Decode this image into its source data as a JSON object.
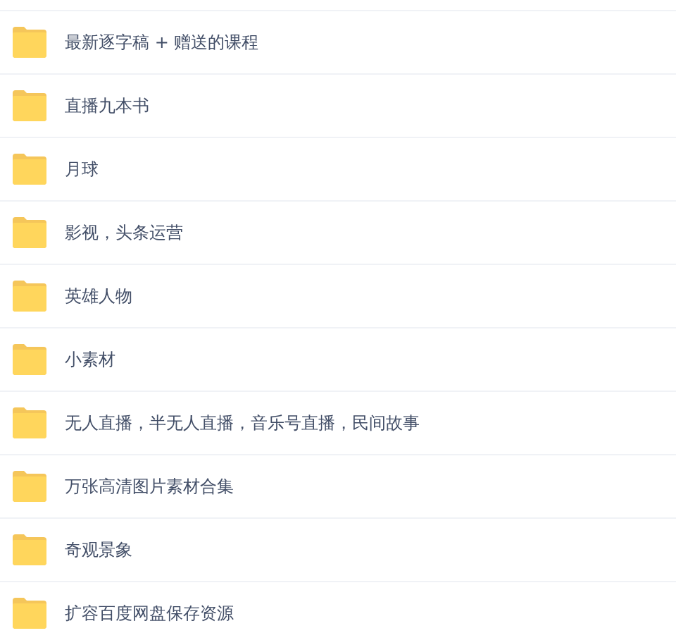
{
  "folders": [
    {
      "name": "最新逐字稿 + 赠送的课程"
    },
    {
      "name": "直播九本书"
    },
    {
      "name": "月球"
    },
    {
      "name": "影视，头条运营"
    },
    {
      "name": "英雄人物"
    },
    {
      "name": "小素材"
    },
    {
      "name": "无人直播，半无人直播，音乐号直播，民间故事"
    },
    {
      "name": "万张高清图片素材合集"
    },
    {
      "name": "奇观景象"
    },
    {
      "name": "扩容百度网盘保存资源"
    }
  ]
}
